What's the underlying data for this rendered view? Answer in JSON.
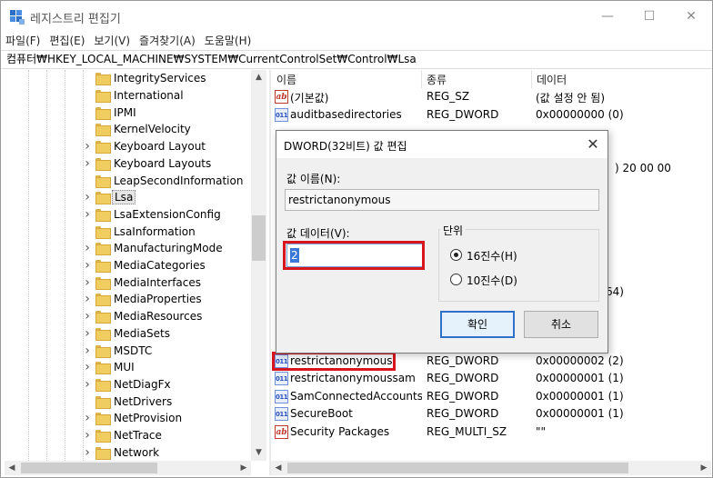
{
  "window": {
    "title": "레지스트리 편집기",
    "minimize": "—",
    "maximize": "☐",
    "close": "✕"
  },
  "menu": [
    "파일(F)",
    "편집(E)",
    "보기(V)",
    "즐겨찾기(A)",
    "도움말(H)"
  ],
  "address": "컴퓨터₩HKEY_LOCAL_MACHINE₩SYSTEM₩CurrentControlSet₩Control₩Lsa",
  "tree": {
    "items": [
      {
        "label": "IntegrityServices",
        "expandable": false
      },
      {
        "label": "International",
        "expandable": false
      },
      {
        "label": "IPMI",
        "expandable": false
      },
      {
        "label": "KernelVelocity",
        "expandable": false
      },
      {
        "label": "Keyboard Layout",
        "expandable": true
      },
      {
        "label": "Keyboard Layouts",
        "expandable": true
      },
      {
        "label": "LeapSecondInformation",
        "expandable": false
      },
      {
        "label": "Lsa",
        "expandable": true,
        "selected": true
      },
      {
        "label": "LsaExtensionConfig",
        "expandable": true
      },
      {
        "label": "LsaInformation",
        "expandable": false
      },
      {
        "label": "ManufacturingMode",
        "expandable": true
      },
      {
        "label": "MediaCategories",
        "expandable": true
      },
      {
        "label": "MediaInterfaces",
        "expandable": true
      },
      {
        "label": "MediaProperties",
        "expandable": true
      },
      {
        "label": "MediaResources",
        "expandable": true
      },
      {
        "label": "MediaSets",
        "expandable": true
      },
      {
        "label": "MSDTC",
        "expandable": true
      },
      {
        "label": "MUI",
        "expandable": true
      },
      {
        "label": "NetDiagFx",
        "expandable": true
      },
      {
        "label": "NetDrivers",
        "expandable": false
      },
      {
        "label": "NetProvision",
        "expandable": true
      },
      {
        "label": "NetTrace",
        "expandable": true
      },
      {
        "label": "Network",
        "expandable": true
      }
    ]
  },
  "list": {
    "headers": {
      "name": "이름",
      "type": "종류",
      "data": "데이터"
    },
    "rows": [
      {
        "icon": "sz",
        "name": "(기본값)",
        "type": "REG_SZ",
        "data": "(값 설정 안 됨)"
      },
      {
        "icon": "dw",
        "name": "auditbasedirectories",
        "type": "REG_DWORD",
        "data": "0x00000000 (0)"
      },
      {
        "icon": "dw",
        "name": "restrictanonymous",
        "type": "REG_DWORD",
        "data": "0x00000002 (2)",
        "highlighted": true
      },
      {
        "icon": "dw",
        "name": "restrictanonymoussam",
        "type": "REG_DWORD",
        "data": "0x00000001 (1)"
      },
      {
        "icon": "dw",
        "name": "SamConnectedAccounts...",
        "type": "REG_DWORD",
        "data": "0x00000001 (1)"
      },
      {
        "icon": "dw",
        "name": "SecureBoot",
        "type": "REG_DWORD",
        "data": "0x00000001 (1)"
      },
      {
        "icon": "sz",
        "name": "Security Packages",
        "type": "REG_MULTI_SZ",
        "data": "\"\""
      }
    ],
    "partial_data": [
      ") 20 00 00",
      "64)"
    ]
  },
  "dialog": {
    "title": "DWORD(32비트) 값 편집",
    "close": "✕",
    "name_label": "값 이름(N):",
    "name_value": "restrictanonymous",
    "data_label": "값 데이터(V):",
    "data_value": "2",
    "base_label": "단위",
    "radio_hex": "16진수(H)",
    "radio_dec": "10진수(D)",
    "ok": "확인",
    "cancel": "취소"
  },
  "colors": {
    "highlight": "#d9161e",
    "selection": "#3a79d6"
  }
}
